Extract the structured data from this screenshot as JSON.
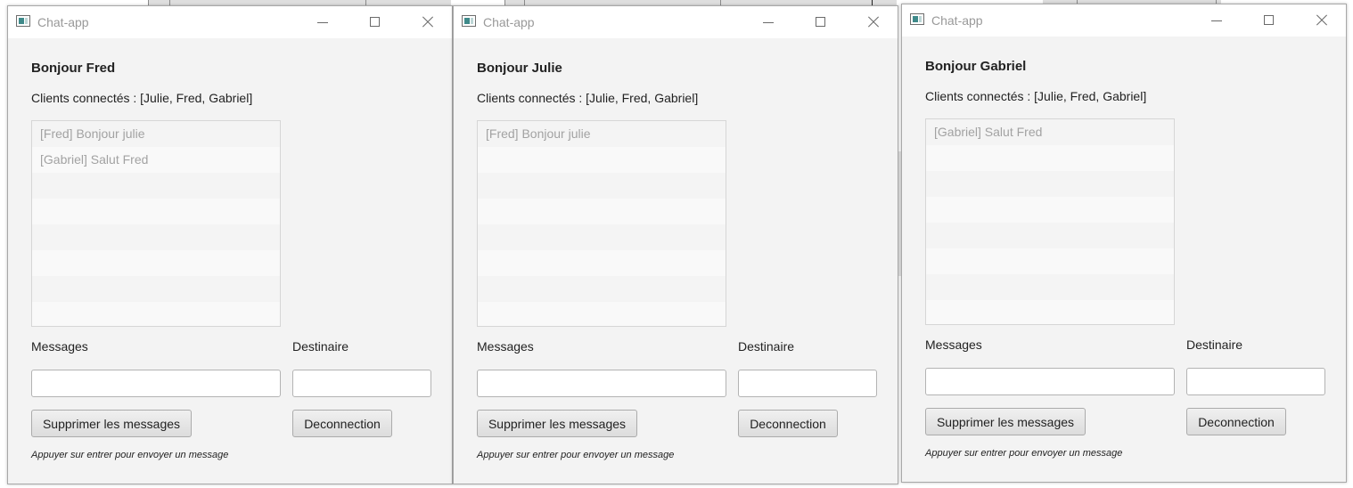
{
  "windows": [
    {
      "title": "Chat-app",
      "greeting": "Bonjour Fred",
      "clients": "Clients connectés : [Julie, Fred, Gabriel]",
      "messages": [
        "[Fred] Bonjour julie",
        "[Gabriel] Salut Fred"
      ],
      "messages_label": "Messages",
      "recipient_label": "Destinaire",
      "message_value": "",
      "recipient_value": "",
      "clear_button": "Supprimer les messages",
      "disconnect_button": "Deconnection",
      "hint": "Appuyer sur entrer pour envoyer un message"
    },
    {
      "title": "Chat-app",
      "greeting": "Bonjour Julie",
      "clients": "Clients connectés : [Julie, Fred, Gabriel]",
      "messages": [
        "[Fred] Bonjour julie"
      ],
      "messages_label": "Messages",
      "recipient_label": "Destinaire",
      "message_value": "",
      "recipient_value": "",
      "clear_button": "Supprimer les messages",
      "disconnect_button": "Deconnection",
      "hint": "Appuyer sur entrer pour envoyer un message"
    },
    {
      "title": "Chat-app",
      "greeting": "Bonjour Gabriel",
      "clients": "Clients connectés : [Julie, Fred, Gabriel]",
      "messages": [
        "[Gabriel] Salut Fred"
      ],
      "messages_label": "Messages",
      "recipient_label": "Destinaire",
      "message_value": "",
      "recipient_value": "",
      "clear_button": "Supprimer les messages",
      "disconnect_button": "Deconnection",
      "hint": "Appuyer sur entrer pour envoyer un message"
    }
  ],
  "icons": {
    "app": "app-window-icon",
    "minimize": "minimize-icon",
    "maximize": "maximize-icon",
    "close": "close-icon"
  },
  "colors": {
    "window_bg": "#f3f3f3",
    "titlebar_bg": "#ffffff",
    "title_text": "#999999",
    "list_item_text": "#a2a2a2",
    "icon_accent": "#3f8a8a"
  }
}
